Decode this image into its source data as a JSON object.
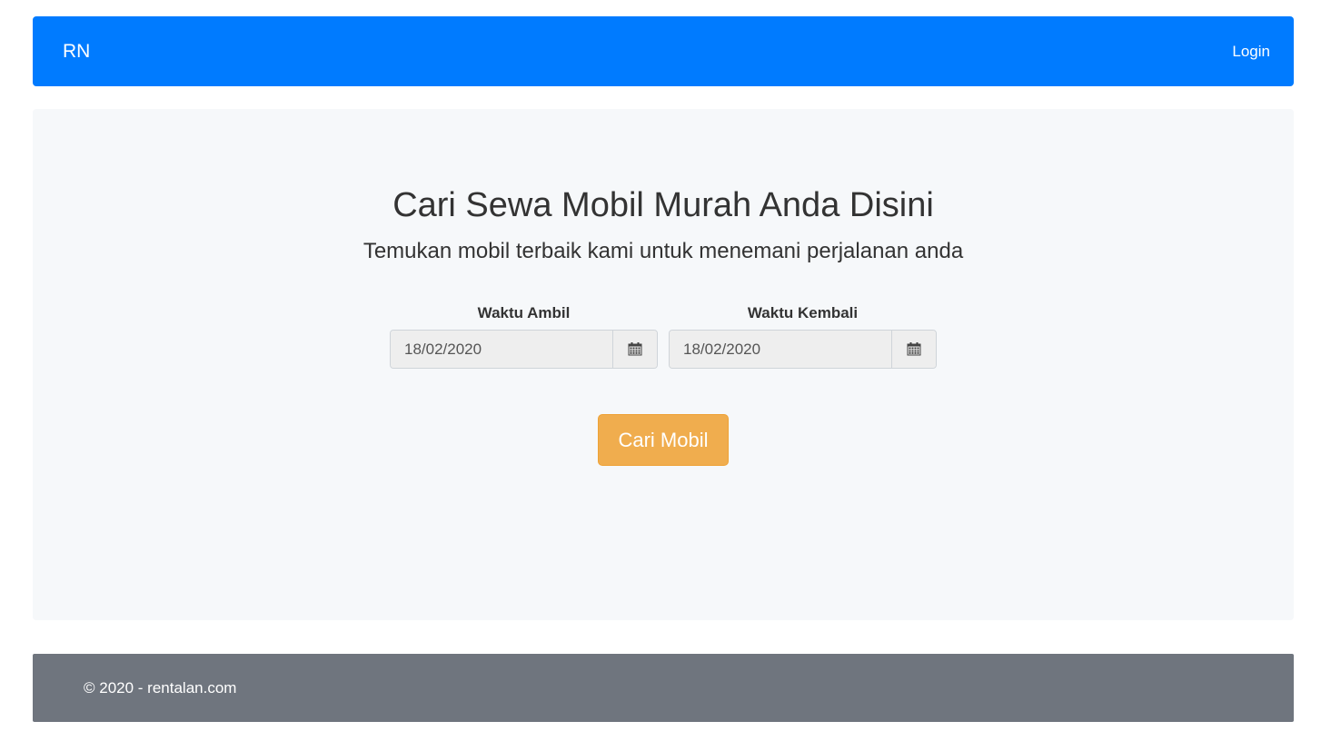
{
  "navbar": {
    "brand": "RN",
    "login_label": "Login",
    "color": "#007bff"
  },
  "hero": {
    "title": "Cari Sewa Mobil Murah Anda Disini",
    "subtitle": "Temukan mobil terbaik kami untuk menemani perjalanan anda"
  },
  "form": {
    "pickup": {
      "label": "Waktu Ambil",
      "value": "18/02/2020",
      "icon": "calendar-icon"
    },
    "return": {
      "label": "Waktu Kembali",
      "value": "18/02/2020",
      "icon": "calendar-icon"
    },
    "search_label": "Cari Mobil",
    "search_color": "#f0ad4e"
  },
  "footer": {
    "text": "© 2020 - rentalan.com",
    "color": "#6f757e"
  }
}
